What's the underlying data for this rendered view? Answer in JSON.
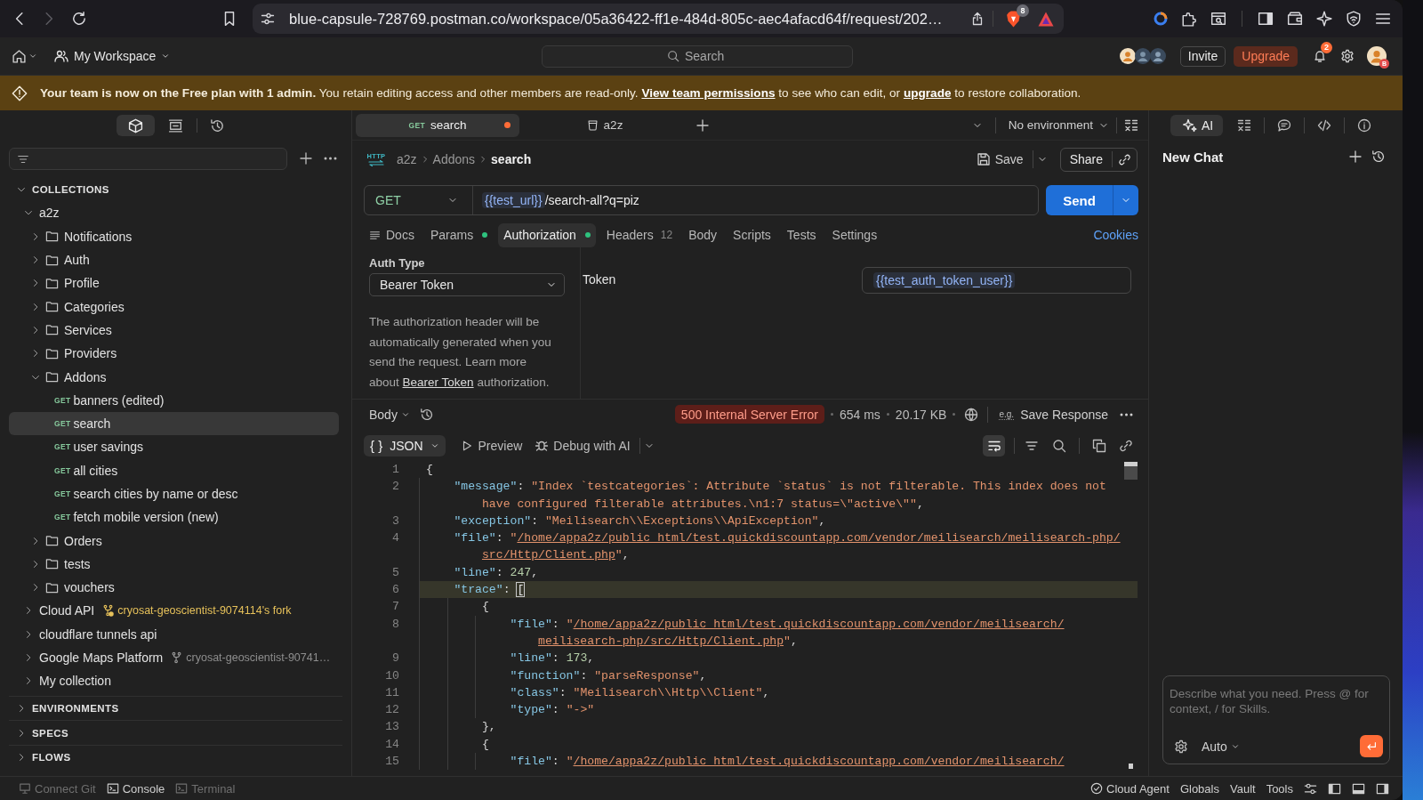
{
  "browser": {
    "url": "blue-capsule-728769.postman.co/workspace/05a36422-ff1e-484d-805c-aec4afacd64f/request/202…",
    "forward_enabled": false,
    "shields_badge": "8"
  },
  "header": {
    "workspace": "My Workspace",
    "search": {
      "placeholder": "Search"
    },
    "invite": "Invite",
    "upgrade": "Upgrade",
    "notifications": "2",
    "avatar_badge": "B"
  },
  "banner": {
    "parts": [
      {
        "kind": "text",
        "text": "**Your team is now on the Free plan with 1 admin.** You retain editing access and other members are read-only."
      },
      {
        "kind": "link",
        "text": "View team permissions"
      },
      {
        "kind": "text",
        "text": "to see who can edit, or"
      },
      {
        "kind": "link",
        "text": "upgrade"
      },
      {
        "kind": "text",
        "text": "to restore collaboration."
      }
    ]
  },
  "sidebar": {
    "views": [
      {
        "kind": "collections",
        "selected": true
      },
      {
        "kind": "mock",
        "selected": false
      },
      {
        "kind": "history",
        "selected": false
      }
    ],
    "sections": [
      {
        "title": "COLLECTIONS",
        "expanded": true,
        "children": [
          {
            "kind": "collection",
            "name": "a2z",
            "expanded": true,
            "selected": false,
            "children": [
              {
                "kind": "folder",
                "name": "Notifications",
                "expanded": false,
                "selected": false
              },
              {
                "kind": "folder",
                "name": "Auth",
                "expanded": false,
                "selected": false
              },
              {
                "kind": "folder",
                "name": "Profile",
                "expanded": false,
                "selected": false
              },
              {
                "kind": "folder",
                "name": "Categories",
                "expanded": false,
                "selected": false
              },
              {
                "kind": "folder",
                "name": "Services",
                "expanded": false,
                "selected": false
              },
              {
                "kind": "folder",
                "name": "Providers",
                "expanded": false,
                "selected": false
              },
              {
                "kind": "folder",
                "name": "Addons",
                "expanded": true,
                "selected": false,
                "children": [
                  {
                    "kind": "request",
                    "method": "GET",
                    "name": "banners (edited)",
                    "selected": false
                  },
                  {
                    "kind": "request",
                    "method": "GET",
                    "name": "search",
                    "selected": true
                  },
                  {
                    "kind": "request",
                    "method": "GET",
                    "name": "user savings",
                    "selected": false
                  },
                  {
                    "kind": "request",
                    "method": "GET",
                    "name": "all cities",
                    "selected": false
                  },
                  {
                    "kind": "request",
                    "method": "GET",
                    "name": "search cities by name or desc",
                    "selected": false
                  },
                  {
                    "kind": "request",
                    "method": "GET",
                    "name": "fetch mobile version (new)",
                    "selected": false
                  }
                ]
              },
              {
                "kind": "folder",
                "name": "Orders",
                "expanded": false,
                "selected": false
              },
              {
                "kind": "folder",
                "name": "tests",
                "expanded": false,
                "selected": false
              },
              {
                "kind": "folder",
                "name": "vouchers",
                "expanded": false,
                "selected": false
              }
            ]
          },
          {
            "kind": "collection",
            "name": "Cloud API",
            "expanded": false,
            "selected": false,
            "fork": {
              "label": "cryosat-geoscientist-9074114's fork",
              "warning": true
            }
          },
          {
            "kind": "collection",
            "name": "cloudflare tunnels api",
            "expanded": false,
            "selected": false
          },
          {
            "kind": "collection",
            "name": "Google Maps Platform",
            "expanded": false,
            "selected": false,
            "fork": {
              "label": "cryosat-geoscientist-90741…",
              "warning": false
            }
          },
          {
            "kind": "collection",
            "name": "My collection",
            "expanded": false,
            "selected": false
          }
        ]
      },
      {
        "title": "ENVIRONMENTS",
        "expanded": false
      },
      {
        "title": "SPECS",
        "expanded": false
      },
      {
        "title": "FLOWS",
        "expanded": false
      }
    ]
  },
  "tabs": [
    {
      "kind": "request",
      "method": "GET",
      "label": "search",
      "selected": true,
      "unsaved": true
    },
    {
      "kind": "collection",
      "label": "a2z",
      "selected": false,
      "unsaved": false
    }
  ],
  "environment": "No environment",
  "request": {
    "protocol": "HTTP",
    "breadcrumb": [
      "a2z",
      "Addons",
      "search"
    ],
    "save": "Save",
    "share": "Share",
    "method": "GET",
    "url": {
      "variable": "{{test_url}}",
      "path": "/search-all?q=piz"
    },
    "send": "Send",
    "tabs": [
      {
        "kind": "docs",
        "label": "Docs",
        "selected": false,
        "dot": false
      },
      {
        "kind": "plain",
        "label": "Params",
        "selected": false,
        "dot": true
      },
      {
        "kind": "plain",
        "label": "Authorization",
        "selected": true,
        "dot": true
      },
      {
        "kind": "plain",
        "label": "Headers",
        "count": "12",
        "selected": false,
        "dot": false
      },
      {
        "kind": "plain",
        "label": "Body",
        "selected": false,
        "dot": false
      },
      {
        "kind": "plain",
        "label": "Scripts",
        "selected": false,
        "dot": false
      },
      {
        "kind": "plain",
        "label": "Tests",
        "selected": false,
        "dot": false
      },
      {
        "kind": "plain",
        "label": "Settings",
        "selected": false,
        "dot": false
      }
    ],
    "cookies": "Cookies"
  },
  "auth": {
    "type_label": "Auth Type",
    "type": "Bearer Token",
    "description": [
      {
        "kind": "text",
        "text": "The authorization header will be automatically generated when you send the request. Learn more about"
      },
      {
        "kind": "link",
        "text": "Bearer Token"
      },
      {
        "kind": "text",
        "text": "authorization."
      }
    ],
    "token_label": "Token",
    "token": "{{test_auth_token_user}}"
  },
  "response": {
    "view": "Body",
    "status": {
      "kind": "error",
      "text": "500 Internal Server Error"
    },
    "time": "654 ms",
    "size": "20.17 KB",
    "example_mark": "e.g.",
    "save": "Save Response",
    "format": {
      "glyph": "{ }",
      "label": "JSON"
    },
    "preview": "Preview",
    "debug": "Debug with AI",
    "wrap_lines": true,
    "lines": [
      {
        "number": "1",
        "active": false,
        "segments": [
          {
            "tokens": [
              {
                "kind": "punct",
                "text": "{"
              }
            ]
          }
        ]
      },
      {
        "number": "2",
        "active": false,
        "segments": [
          {
            "tokens": [
              {
                "kind": "key",
                "text": "    \"message\""
              },
              {
                "kind": "punct",
                "text": ": "
              },
              {
                "kind": "string",
                "text": "\"Index `testcategories`: Attribute `status` is not filterable. This index does not"
              }
            ]
          },
          {
            "tokens": [
              {
                "kind": "string",
                "text": "have configured filterable attributes.\\n1:7 status=\\\"active\\\"\""
              },
              {
                "kind": "punct",
                "text": ","
              }
            ]
          }
        ]
      },
      {
        "number": "3",
        "active": false,
        "segments": [
          {
            "tokens": [
              {
                "kind": "key",
                "text": "    \"exception\""
              },
              {
                "kind": "punct",
                "text": ": "
              },
              {
                "kind": "string",
                "text": "\"Meilisearch\\\\Exceptions\\\\ApiException\""
              },
              {
                "kind": "punct",
                "text": ","
              }
            ]
          }
        ]
      },
      {
        "number": "4",
        "active": false,
        "segments": [
          {
            "tokens": [
              {
                "kind": "key",
                "text": "    \"file\""
              },
              {
                "kind": "punct",
                "text": ": "
              },
              {
                "kind": "string",
                "text": "\""
              },
              {
                "kind": "link",
                "text": "/home/appa2z/public_html/test.quickdiscountapp.com/vendor/meilisearch/meilisearch-php/"
              }
            ]
          },
          {
            "tokens": [
              {
                "kind": "link",
                "text": "src/Http/Client.php"
              },
              {
                "kind": "string",
                "text": "\""
              },
              {
                "kind": "punct",
                "text": ","
              }
            ]
          }
        ]
      },
      {
        "number": "5",
        "active": false,
        "segments": [
          {
            "tokens": [
              {
                "kind": "key",
                "text": "    \"line\""
              },
              {
                "kind": "punct",
                "text": ": "
              },
              {
                "kind": "number",
                "text": "247"
              },
              {
                "kind": "punct",
                "text": ","
              }
            ]
          }
        ]
      },
      {
        "number": "6",
        "active": true,
        "segments": [
          {
            "tokens": [
              {
                "kind": "key",
                "text": "    \"trace\""
              },
              {
                "kind": "punct",
                "text": ": "
              },
              {
                "kind": "bracket",
                "text": "["
              }
            ]
          }
        ]
      },
      {
        "number": "7",
        "active": false,
        "segments": [
          {
            "tokens": [
              {
                "kind": "punct",
                "text": "        {"
              }
            ]
          }
        ]
      },
      {
        "number": "8",
        "active": false,
        "segments": [
          {
            "tokens": [
              {
                "kind": "key",
                "text": "            \"file\""
              },
              {
                "kind": "punct",
                "text": ": "
              },
              {
                "kind": "string",
                "text": "\""
              },
              {
                "kind": "link",
                "text": "/home/appa2z/public_html/test.quickdiscountapp.com/vendor/meilisearch/"
              }
            ]
          },
          {
            "tokens": [
              {
                "kind": "link",
                "text": "meilisearch-php/src/Http/Client.php"
              },
              {
                "kind": "string",
                "text": "\""
              },
              {
                "kind": "punct",
                "text": ","
              }
            ]
          }
        ]
      },
      {
        "number": "9",
        "active": false,
        "segments": [
          {
            "tokens": [
              {
                "kind": "key",
                "text": "            \"line\""
              },
              {
                "kind": "punct",
                "text": ": "
              },
              {
                "kind": "number",
                "text": "173"
              },
              {
                "kind": "punct",
                "text": ","
              }
            ]
          }
        ]
      },
      {
        "number": "10",
        "active": false,
        "segments": [
          {
            "tokens": [
              {
                "kind": "key",
                "text": "            \"function\""
              },
              {
                "kind": "punct",
                "text": ": "
              },
              {
                "kind": "string",
                "text": "\"parseResponse\""
              },
              {
                "kind": "punct",
                "text": ","
              }
            ]
          }
        ]
      },
      {
        "number": "11",
        "active": false,
        "segments": [
          {
            "tokens": [
              {
                "kind": "key",
                "text": "            \"class\""
              },
              {
                "kind": "punct",
                "text": ": "
              },
              {
                "kind": "string",
                "text": "\"Meilisearch\\\\Http\\\\Client\""
              },
              {
                "kind": "punct",
                "text": ","
              }
            ]
          }
        ]
      },
      {
        "number": "12",
        "active": false,
        "segments": [
          {
            "tokens": [
              {
                "kind": "key",
                "text": "            \"type\""
              },
              {
                "kind": "punct",
                "text": ": "
              },
              {
                "kind": "string",
                "text": "\"->\""
              }
            ]
          }
        ]
      },
      {
        "number": "13",
        "active": false,
        "segments": [
          {
            "tokens": [
              {
                "kind": "punct",
                "text": "        },"
              }
            ]
          }
        ]
      },
      {
        "number": "14",
        "active": false,
        "segments": [
          {
            "tokens": [
              {
                "kind": "punct",
                "text": "        {"
              }
            ]
          }
        ]
      },
      {
        "number": "15",
        "active": false,
        "segments": [
          {
            "tokens": [
              {
                "kind": "key",
                "text": "            \"file\""
              },
              {
                "kind": "punct",
                "text": ": "
              },
              {
                "kind": "string",
                "text": "\""
              },
              {
                "kind": "link",
                "text": "/home/appa2z/public_html/test.quickdiscountapp.com/vendor/meilisearch/"
              }
            ]
          }
        ]
      }
    ]
  },
  "assistant": {
    "tabs": [
      {
        "kind": "ai",
        "label": "AI",
        "selected": true
      },
      {
        "kind": "variables",
        "selected": false
      },
      {
        "kind": "comments",
        "selected": false
      },
      {
        "kind": "code",
        "selected": false
      },
      {
        "kind": "info",
        "selected": false
      }
    ],
    "title": "New Chat",
    "input": {
      "placeholder": "Describe what you need. Press @ for context, / for Skills."
    },
    "mode": "Auto"
  },
  "status_bar": {
    "left": [
      {
        "kind": "git",
        "label": "Connect Git",
        "disabled": true
      },
      {
        "kind": "console",
        "label": "Console",
        "disabled": false
      },
      {
        "kind": "terminal",
        "label": "Terminal",
        "disabled": true
      }
    ],
    "right": [
      {
        "kind": "agent",
        "label": "Cloud Agent"
      },
      {
        "kind": "text",
        "label": "Globals"
      },
      {
        "kind": "text",
        "label": "Vault"
      },
      {
        "kind": "text",
        "label": "Tools"
      }
    ]
  }
}
